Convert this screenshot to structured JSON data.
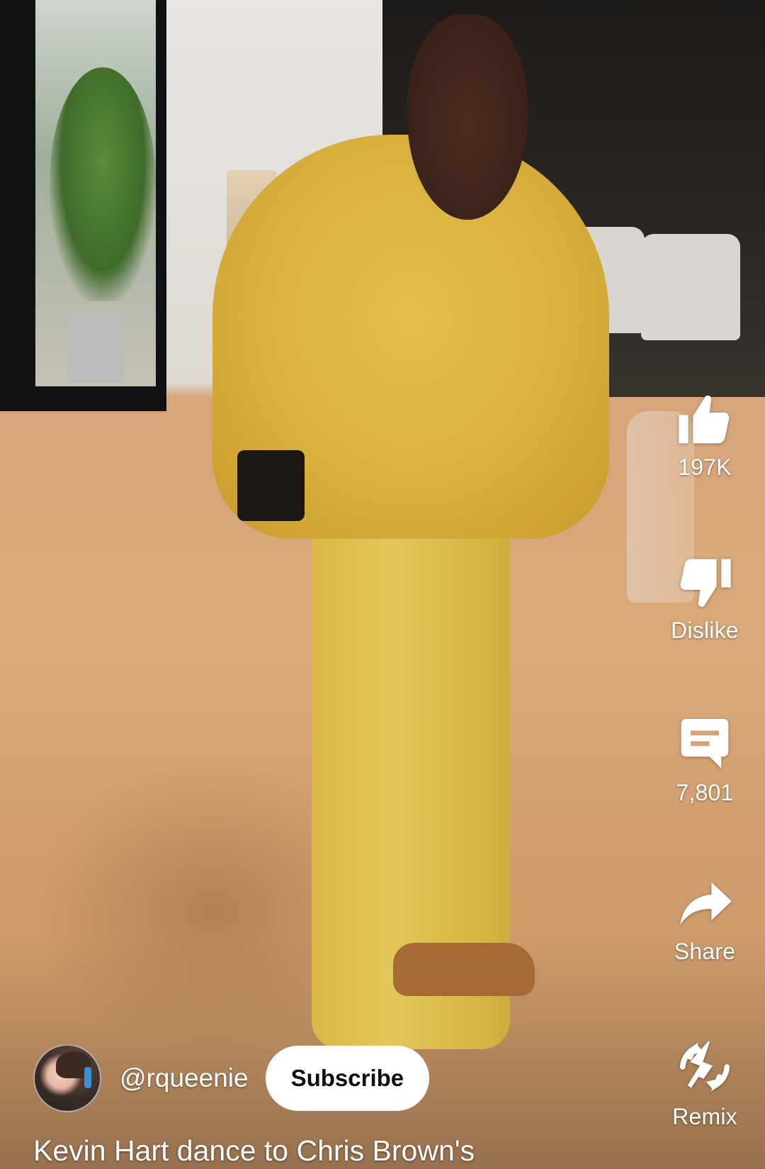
{
  "actions": {
    "like": {
      "icon": "thumbs-up-icon",
      "label": "197K"
    },
    "dislike": {
      "icon": "thumbs-down-icon",
      "label": "Dislike"
    },
    "comments": {
      "icon": "comment-icon",
      "label": "7,801"
    },
    "share": {
      "icon": "share-arrow-icon",
      "label": "Share"
    },
    "remix": {
      "icon": "remix-icon",
      "label": "Remix"
    }
  },
  "channel": {
    "handle": "@rqueenie",
    "subscribe_label": "Subscribe"
  },
  "video": {
    "title": "Kevin Hart dance to Chris Brown's"
  },
  "colors": {
    "icon": "#ffffff",
    "subscribe_bg": "#ffffff",
    "subscribe_text": "#0f0f0f"
  }
}
